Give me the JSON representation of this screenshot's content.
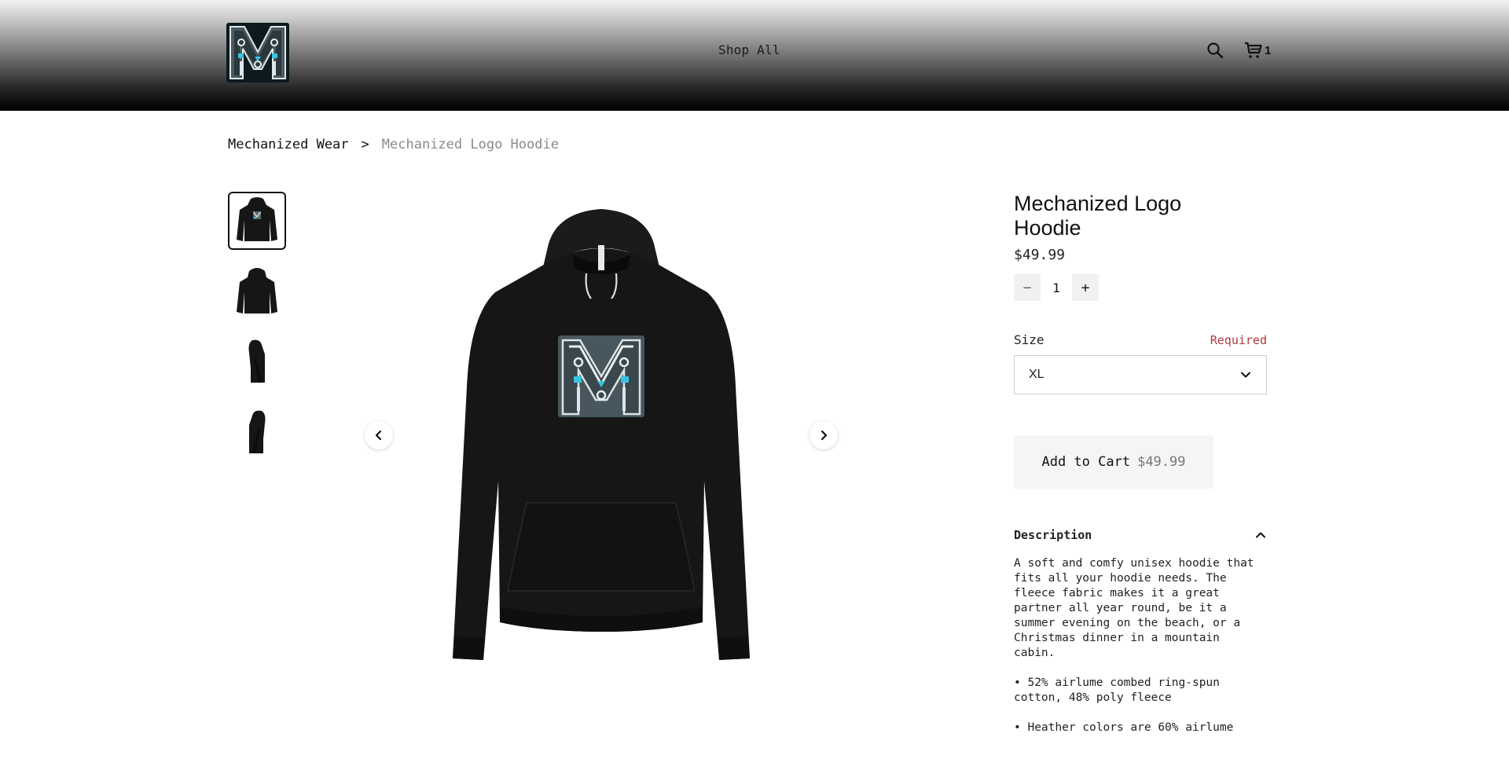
{
  "header": {
    "nav_shop_all": "Shop All",
    "cart_count": "1",
    "logo_icon": "mechanized-m-logo",
    "search_icon": "magnifier",
    "cart_icon": "shopping-cart"
  },
  "breadcrumb": {
    "home": "Mechanized Wear",
    "separator": ">",
    "current": "Mechanized Logo Hoodie"
  },
  "gallery": {
    "thumbnails": [
      {
        "view": "front",
        "selected": true
      },
      {
        "view": "back",
        "selected": false
      },
      {
        "view": "left-side",
        "selected": false
      },
      {
        "view": "right-side",
        "selected": false
      }
    ],
    "prev_icon": "chevron-left",
    "next_icon": "chevron-right"
  },
  "product": {
    "title": "Mechanized Logo Hoodie",
    "price": "$49.99",
    "quantity": "1",
    "qty_minus": "−",
    "qty_plus": "+",
    "size_label": "Size",
    "size_required": "Required",
    "size_selected": "XL",
    "add_to_cart_label": "Add to Cart",
    "add_to_cart_price": "$49.99",
    "description_title": "Description",
    "description_text": "A soft and comfy unisex hoodie that fits all your hoodie needs. The fleece fabric makes it a great partner all year round, be it a summer evening on the beach, or a Christmas dinner in a mountain cabin.",
    "bullets": [
      "• 52% airlume combed ring-spun cotton, 48% poly fleece",
      "• Heather colors are 60% airlume"
    ]
  },
  "colors": {
    "accent_cyan": "#35c4e0",
    "required_red": "#b0393f",
    "hoodie_black": "#141414"
  }
}
